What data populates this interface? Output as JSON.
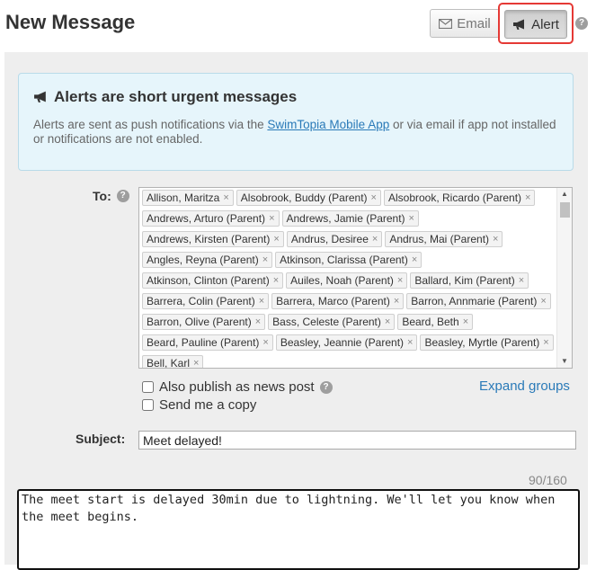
{
  "header": {
    "title": "New Message",
    "email_button": "Email",
    "alert_button": "Alert",
    "help_symbol": "?"
  },
  "info": {
    "title": "Alerts are short urgent messages",
    "text_before": "Alerts are sent as push notifications via the ",
    "link": "SwimTopia Mobile App",
    "text_after": " or via email if app not installed or notifications are not enabled."
  },
  "to": {
    "label": "To:",
    "recipients": [
      "Allison, Maritza",
      "Alsobrook, Buddy (Parent)",
      "Alsobrook, Ricardo (Parent)",
      "Andrews, Arturo (Parent)",
      "Andrews, Jamie (Parent)",
      "Andrews, Kirsten (Parent)",
      "Andrus, Desiree",
      "Andrus, Mai (Parent)",
      "Angles, Reyna (Parent)",
      "Atkinson, Clarissa (Parent)",
      "Atkinson, Clinton (Parent)",
      "Auiles, Noah (Parent)",
      "Ballard, Kim (Parent)",
      "Barrera, Colin (Parent)",
      "Barrera, Marco (Parent)",
      "Barron, Annmarie (Parent)",
      "Barron, Olive (Parent)",
      "Bass, Celeste (Parent)",
      "Beard, Beth",
      "Beard, Pauline (Parent)",
      "Beasley, Jeannie (Parent)",
      "Beasley, Myrtle (Parent)",
      "Bell, Karl"
    ],
    "remove_symbol": "×"
  },
  "options": {
    "publish_label": "Also publish as news post",
    "copy_label": "Send me a copy",
    "expand_groups": "Expand groups"
  },
  "subject": {
    "label": "Subject:",
    "value": "Meet delayed!"
  },
  "body": {
    "counter": "90/160",
    "value": "The meet start is delayed 30min due to lightning. We'll let you know when the meet begins."
  },
  "icons": {
    "email": "envelope-icon",
    "alert": "megaphone-icon",
    "help": "question-circle-icon"
  },
  "colors": {
    "link": "#2a7ab8",
    "info_bg": "#e6f5fb",
    "alert_highlight": "#e53935",
    "panel_bg": "#eeeeee"
  }
}
